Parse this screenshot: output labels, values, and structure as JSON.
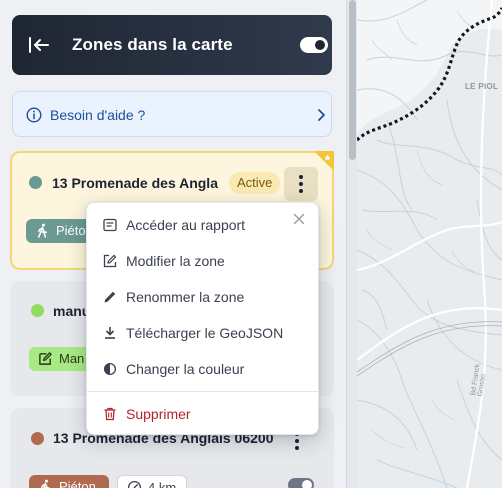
{
  "header": {
    "title": "Zones dans la carte",
    "back_icon": "arrow-left-to-bar-icon",
    "toggle_on": true
  },
  "help": {
    "label": "Besoin d'aide ?"
  },
  "zones": [
    {
      "name": "13 Promenade des Angla",
      "color": "#6b9a92",
      "status": "Active",
      "chip": "Piéton",
      "selected": true
    },
    {
      "name": "manu",
      "color": "#8fdc5e",
      "chip": "Man"
    },
    {
      "name": "13 Promenade des Anglais 06200",
      "color": "#b06a50",
      "chip": "Piéton",
      "distance": "4 km"
    }
  ],
  "menu": {
    "items": [
      {
        "label": "Accéder au rapport",
        "icon": "report-icon"
      },
      {
        "label": "Modifier la zone",
        "icon": "edit-icon"
      },
      {
        "label": "Renommer la zone",
        "icon": "pencil-icon"
      },
      {
        "label": "Télécharger le GeoJSON",
        "icon": "download-icon"
      },
      {
        "label": "Changer la couleur",
        "icon": "contrast-icon"
      }
    ],
    "danger": {
      "label": "Supprimer",
      "icon": "trash-icon"
    }
  },
  "map": {
    "place_label": "LE PIOL",
    "road_label": "Bd Franck Grosso"
  },
  "colors": {
    "header": "#1f2633",
    "accent": "#1e4f9a",
    "danger": "#b2242c",
    "highlight": "#f3d67a"
  }
}
